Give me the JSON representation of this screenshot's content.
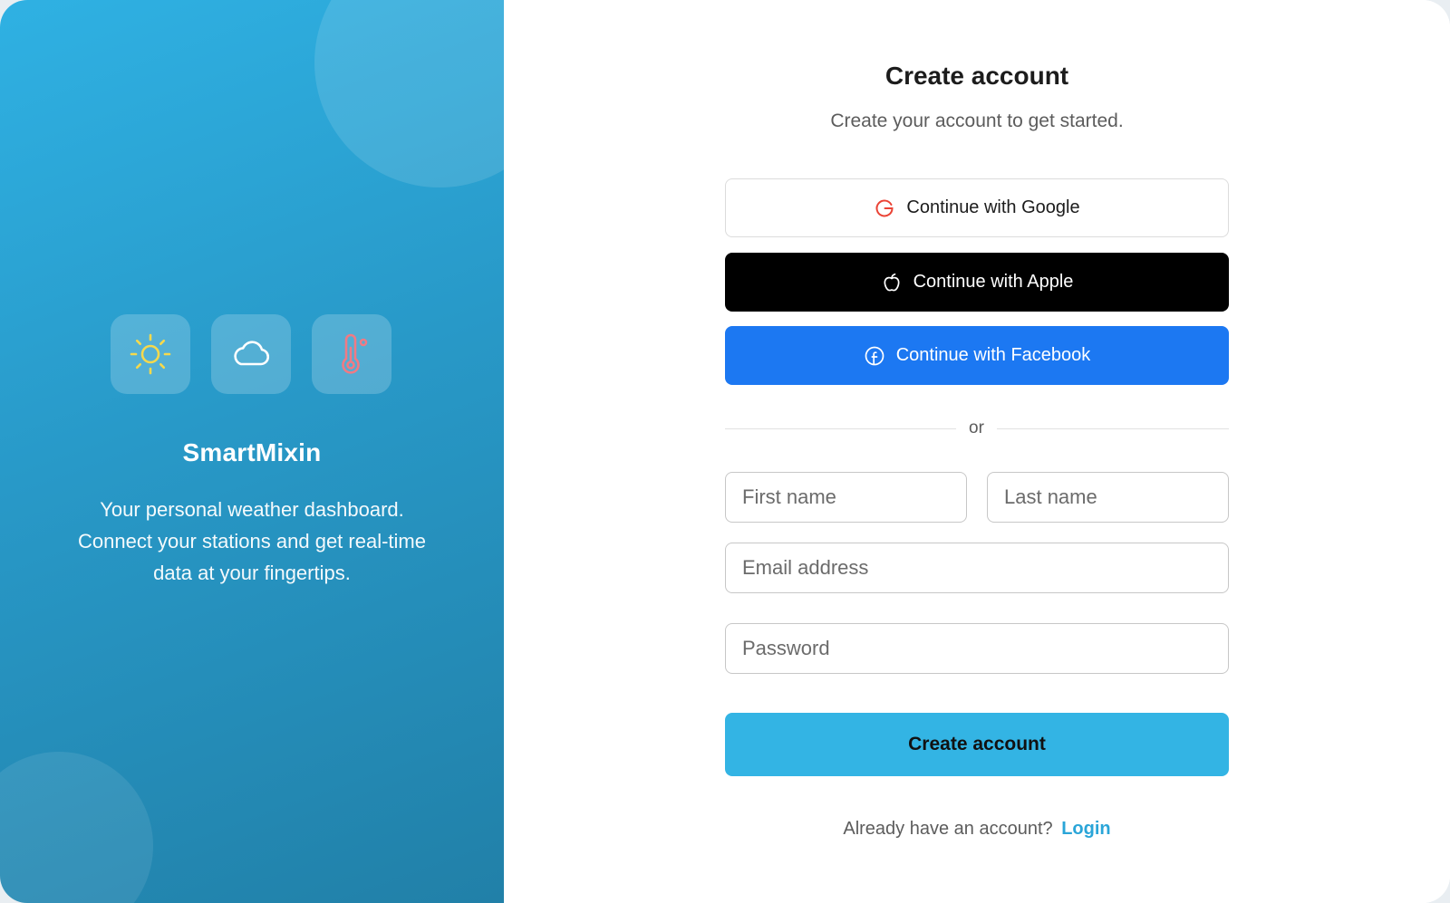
{
  "brand": {
    "name": "SmartMixin",
    "description": "Your personal weather dashboard. Connect your stations and get real-time data at your fingertips.",
    "icons": [
      "sun-icon",
      "cloud-icon",
      "thermometer-icon"
    ]
  },
  "form": {
    "title": "Create account",
    "subtitle": "Create your account to get started.",
    "oauth": {
      "google_label": "Continue with Google",
      "apple_label": "Continue with Apple",
      "facebook_label": "Continue with Facebook"
    },
    "divider_text": "or",
    "fields": {
      "first_name_placeholder": "First name",
      "last_name_placeholder": "Last name",
      "email_placeholder": "Email address",
      "password_placeholder": "Password"
    },
    "submit_label": "Create account",
    "footer": {
      "prompt": "Already have an account?",
      "login_label": "Login"
    }
  },
  "colors": {
    "brand_gradient_start": "#2fb1e3",
    "brand_gradient_end": "#2180a8",
    "facebook_blue": "#1c78f2",
    "submit_blue": "#33b4e4",
    "login_link": "#2aa5d8",
    "sun_yellow": "#f5d94c",
    "thermometer_red": "#f07a84"
  }
}
